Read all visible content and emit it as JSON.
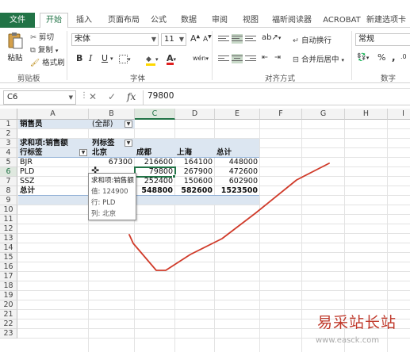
{
  "ribbon": {
    "tabs": [
      "文件",
      "开始",
      "插入",
      "页面布局",
      "公式",
      "数据",
      "审阅",
      "视图",
      "福昕阅读器",
      "ACROBAT",
      "新建选项卡"
    ],
    "active_tab": "开始",
    "clipboard": {
      "paste": "粘贴",
      "cut": "剪切",
      "copy": "复制",
      "format_painter": "格式刷",
      "label": "剪贴板"
    },
    "font": {
      "name": "宋体",
      "size": "11",
      "bold": "B",
      "italic": "I",
      "underline": "U",
      "increase": "A",
      "decrease": "A",
      "label": "字体",
      "wen": "wén"
    },
    "alignment": {
      "wrap": "自动换行",
      "merge": "合并后居中",
      "label": "对齐方式"
    },
    "number": {
      "format": "常规",
      "percent": "%",
      "comma": ",",
      "label": "数字"
    }
  },
  "formula_bar": {
    "name_box": "C6",
    "value": "79800",
    "cancel": "✕",
    "enter": "✓",
    "fx": "fx"
  },
  "sheet": {
    "columns": [
      "A",
      "B",
      "C",
      "D",
      "E",
      "F",
      "G",
      "H",
      "I"
    ],
    "selected_column": "C",
    "rows": [
      "1",
      "2",
      "3",
      "4",
      "5",
      "6",
      "7",
      "8",
      "9",
      "10",
      "11",
      "12",
      "13",
      "14",
      "15",
      "16",
      "17",
      "18",
      "19",
      "20",
      "21",
      "22",
      "23"
    ],
    "selected_row": "6",
    "pivot": {
      "filter_label": "销售员",
      "filter_value": "(全部)",
      "value_label": "求和项:销售额",
      "col_label": "列标签",
      "row_label": "行标签",
      "col_headers": [
        "北京",
        "成都",
        "上海",
        "总计"
      ],
      "rows": [
        {
          "name": "BJR",
          "values": [
            "67300",
            "216600",
            "164100",
            "448000"
          ]
        },
        {
          "name": "PLD",
          "values": [
            "",
            "79800",
            "267900",
            "472600"
          ]
        },
        {
          "name": "SSZ",
          "values": [
            "",
            "252400",
            "150600",
            "602900"
          ]
        }
      ],
      "total": {
        "name": "总计",
        "values": [
          "",
          "548800",
          "582600",
          "1523500"
        ]
      }
    },
    "tooltip": [
      "求和项:销售额",
      "值: 124900",
      "行: PLD",
      "列: 北京"
    ]
  },
  "watermark": {
    "text": "易采站长站",
    "url": "www.easck.com"
  },
  "colors": {
    "accent": "#217346",
    "pivot_band": "#dce6f1",
    "annotation": "#d03b2a",
    "watermark": "#c0392b"
  }
}
